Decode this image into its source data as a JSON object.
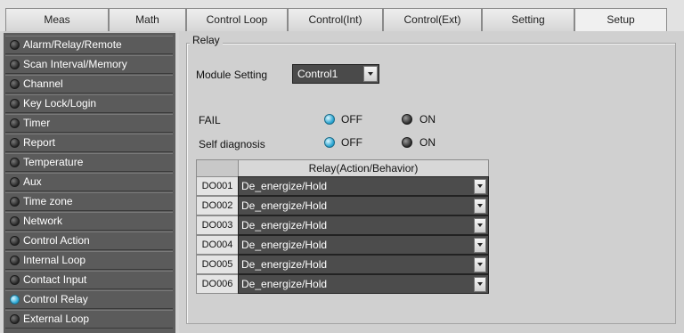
{
  "tabs": [
    {
      "label": "Meas"
    },
    {
      "label": "Math"
    },
    {
      "label": "Control Loop"
    },
    {
      "label": "Control(Int)"
    },
    {
      "label": "Control(Ext)"
    },
    {
      "label": "Setting"
    },
    {
      "label": "Setup",
      "active": true
    }
  ],
  "sidebar": {
    "items": [
      {
        "label": "Alarm/Relay/Remote"
      },
      {
        "label": "Scan Interval/Memory"
      },
      {
        "label": "Channel"
      },
      {
        "label": "Key Lock/Login"
      },
      {
        "label": "Timer"
      },
      {
        "label": "Report"
      },
      {
        "label": "Temperature"
      },
      {
        "label": "Aux"
      },
      {
        "label": "Time zone"
      },
      {
        "label": "Network"
      },
      {
        "label": "Control Action"
      },
      {
        "label": "Internal Loop"
      },
      {
        "label": "Contact Input"
      },
      {
        "label": "Control Relay",
        "selected": true
      },
      {
        "label": "External Loop"
      }
    ]
  },
  "relay": {
    "group_title": "Relay",
    "module_setting": {
      "label": "Module Setting",
      "value": "Control1"
    },
    "fail": {
      "label": "FAIL",
      "off_label": "OFF",
      "on_label": "ON",
      "selected": "OFF"
    },
    "self_diagnosis": {
      "label": "Self diagnosis",
      "off_label": "OFF",
      "on_label": "ON",
      "selected": "OFF"
    },
    "table": {
      "header": "Relay(Action/Behavior)",
      "rows": [
        {
          "id": "DO001",
          "value": "De_energize/Hold"
        },
        {
          "id": "DO002",
          "value": "De_energize/Hold"
        },
        {
          "id": "DO003",
          "value": "De_energize/Hold"
        },
        {
          "id": "DO004",
          "value": "De_energize/Hold"
        },
        {
          "id": "DO005",
          "value": "De_energize/Hold"
        },
        {
          "id": "DO006",
          "value": "De_energize/Hold"
        }
      ]
    }
  },
  "colors": {
    "selected_indicator": "#2ba8d6",
    "sidebar_bg": "#5d5d5d",
    "cell_bg": "#4c4c4c"
  }
}
